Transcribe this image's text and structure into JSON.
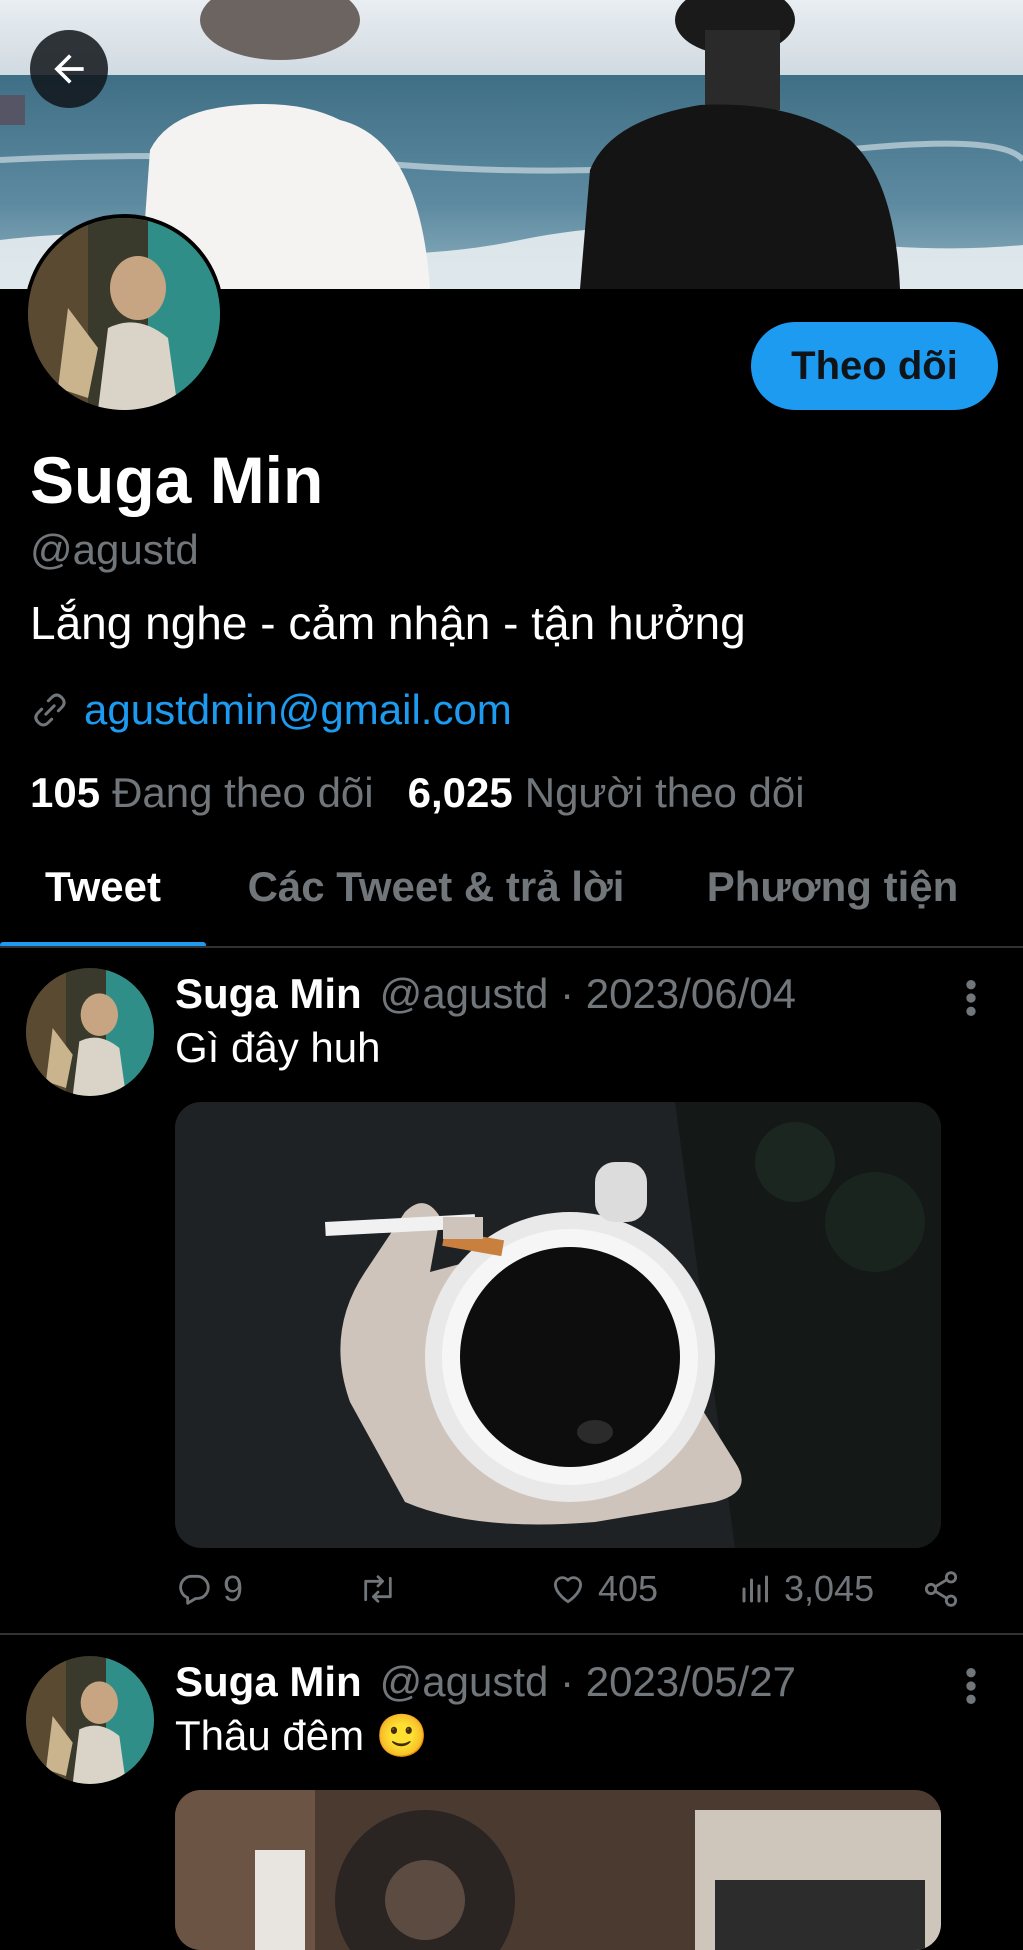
{
  "profile": {
    "display_name": "Suga Min",
    "handle": "@agustd",
    "bio": "Lắng nghe - cảm nhận - tận hưởng",
    "link": "agustdmin@gmail.com",
    "following_count": "105",
    "following_label": "Đang theo dõi",
    "followers_count": "6,025",
    "followers_label": "Người theo dõi",
    "follow_button": "Theo dõi"
  },
  "tabs": [
    {
      "label": "Tweet",
      "active": true
    },
    {
      "label": "Các Tweet & trả lời",
      "active": false
    },
    {
      "label": "Phương tiện",
      "active": false
    }
  ],
  "tweets": [
    {
      "name": "Suga Min",
      "meta": "@agustd · 2023/06/04",
      "text": "Gì đây huh",
      "replies": "9",
      "retweets": "",
      "likes": "405",
      "views": "3,045"
    },
    {
      "name": "Suga Min",
      "meta": "@agustd · 2023/05/27",
      "text": "Thâu đêm 🙂"
    }
  ],
  "colors": {
    "accent": "#1d9bf0",
    "background": "#000000",
    "secondary_text": "#71767b"
  },
  "icons": [
    "back-arrow-icon",
    "link-icon",
    "more-vertical-icon",
    "reply-icon",
    "retweet-icon",
    "like-icon",
    "views-icon",
    "share-icon"
  ]
}
